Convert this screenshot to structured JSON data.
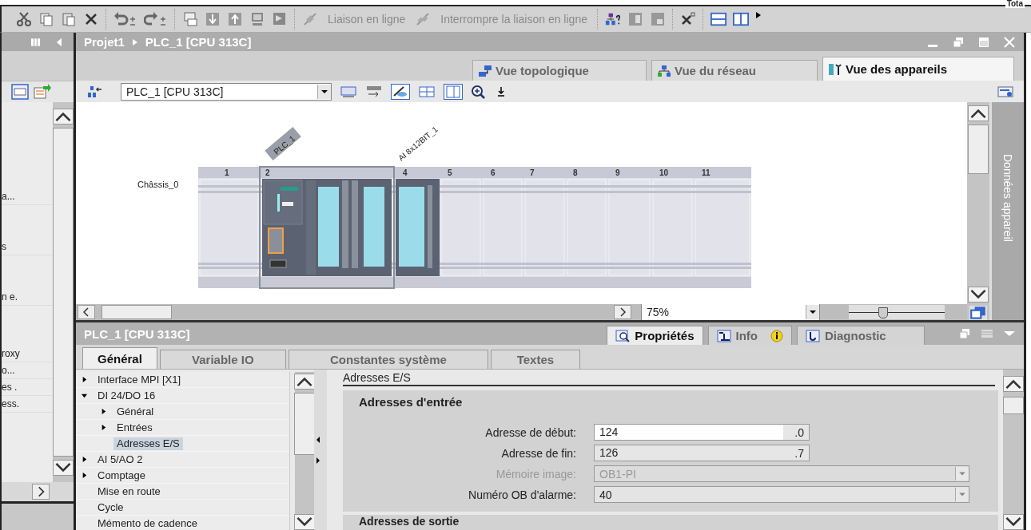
{
  "toolbar": {
    "online_button": "Liaison en ligne",
    "offline_button": "Interrompre la liaison en ligne",
    "corner_text": "Tota"
  },
  "project_tree": {
    "upper_items": [
      "a...",
      "s",
      "n e."
    ],
    "lower_items": [
      "roxy",
      "o...",
      "es .",
      "ess."
    ]
  },
  "editor": {
    "breadcrumb": [
      "Projet1",
      "PLC_1 [CPU 313C]"
    ],
    "view_tabs": [
      {
        "label": "Vue topologique",
        "selected": false
      },
      {
        "label": "Vue du réseau",
        "selected": false
      },
      {
        "label": "Vue des appareils",
        "selected": true
      }
    ],
    "device_select": "PLC_1 [CPU 313C]",
    "rack": {
      "name": "Châssis_0",
      "slots": [
        "1",
        "2",
        "4",
        "5",
        "6",
        "7",
        "8",
        "9",
        "10",
        "11"
      ],
      "modules": [
        "PLC_1",
        "AI 8x12BIT_1"
      ]
    },
    "zoom": "75%",
    "side_tab": "Données appareil"
  },
  "inspector": {
    "title": "PLC_1 [CPU 313C]",
    "tabs": [
      {
        "label": "Propriétés",
        "selected": true
      },
      {
        "label": "Info",
        "selected": false
      },
      {
        "label": "Diagnostic",
        "selected": false
      }
    ],
    "subtabs": [
      {
        "label": "Général",
        "selected": true
      },
      {
        "label": "Variable IO",
        "selected": false
      },
      {
        "label": "Constantes système",
        "selected": false
      },
      {
        "label": "Textes",
        "selected": false
      }
    ],
    "nav": [
      {
        "label": "Interface MPI [X1]",
        "expanded": false,
        "selected": false
      },
      {
        "label": "DI 24/DO 16",
        "expanded": true,
        "selected": false,
        "children": [
          {
            "label": "Général",
            "expanded": false,
            "selected": false
          },
          {
            "label": "Entrées",
            "expanded": false,
            "selected": false
          },
          {
            "label": "Adresses E/S",
            "selected": true
          }
        ]
      },
      {
        "label": "AI 5/AO 2",
        "expanded": false,
        "selected": false
      },
      {
        "label": "Comptage",
        "expanded": false,
        "selected": false
      },
      {
        "label": "Mise en route",
        "selected": false
      },
      {
        "label": "Cycle",
        "selected": false
      },
      {
        "label": "Mémento de cadence",
        "selected": false
      }
    ],
    "section": "Adresses E/S",
    "group": {
      "title": "Adresses d'entrée",
      "fields": [
        {
          "kind": "bit",
          "label": "Adresse de début:",
          "value": "124",
          "suffix": ".0",
          "editable": true
        },
        {
          "kind": "bit",
          "label": "Adresse de fin:",
          "value": "126",
          "suffix": ".7",
          "editable": false
        },
        {
          "kind": "dropdown",
          "label": "Mémoire image:",
          "value": "OB1-PI",
          "disabled": true
        },
        {
          "kind": "dropdown",
          "label": "Numéro OB d'alarme:",
          "value": "40",
          "disabled": false
        }
      ]
    },
    "next_group": "Adresses de sortie"
  }
}
